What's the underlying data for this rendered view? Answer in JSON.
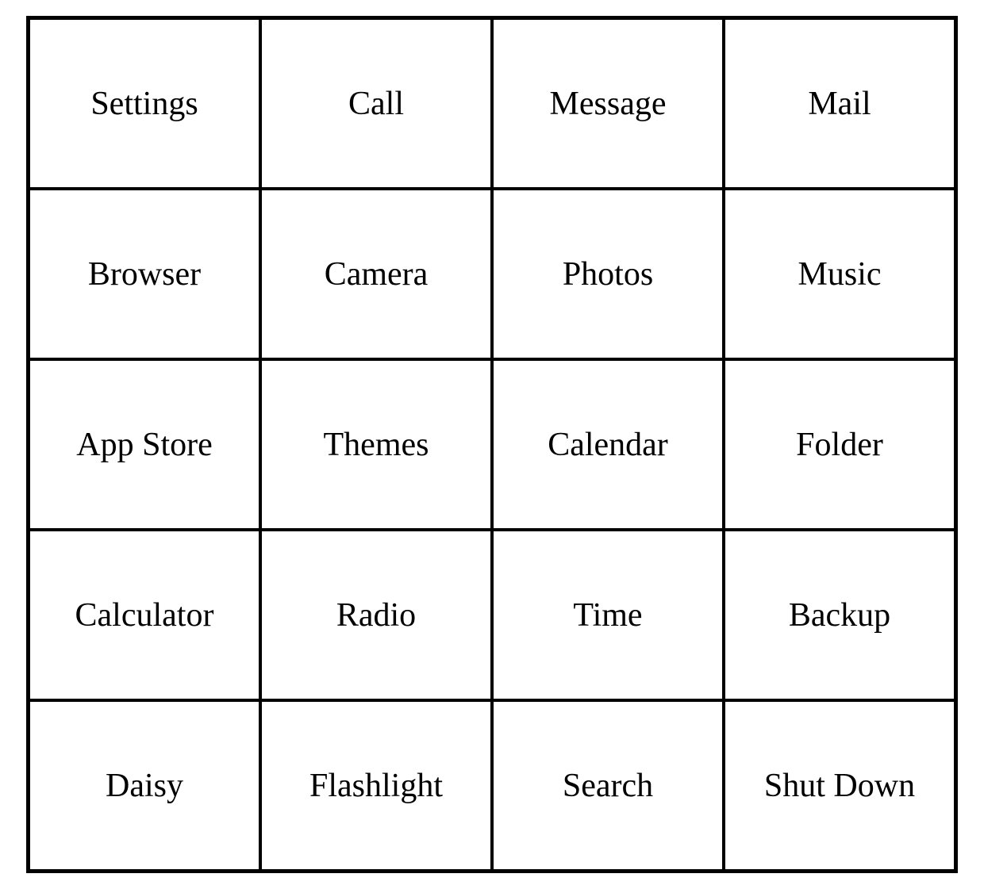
{
  "grid": {
    "rows": [
      [
        "Settings",
        "Call",
        "Message",
        "Mail"
      ],
      [
        "Browser",
        "Camera",
        "Photos",
        "Music"
      ],
      [
        "App Store",
        "Themes",
        "Calendar",
        "Folder"
      ],
      [
        "Calculator",
        "Radio",
        "Time",
        "Backup"
      ],
      [
        "Daisy",
        "Flashlight",
        "Search",
        "Shut Down"
      ]
    ]
  }
}
